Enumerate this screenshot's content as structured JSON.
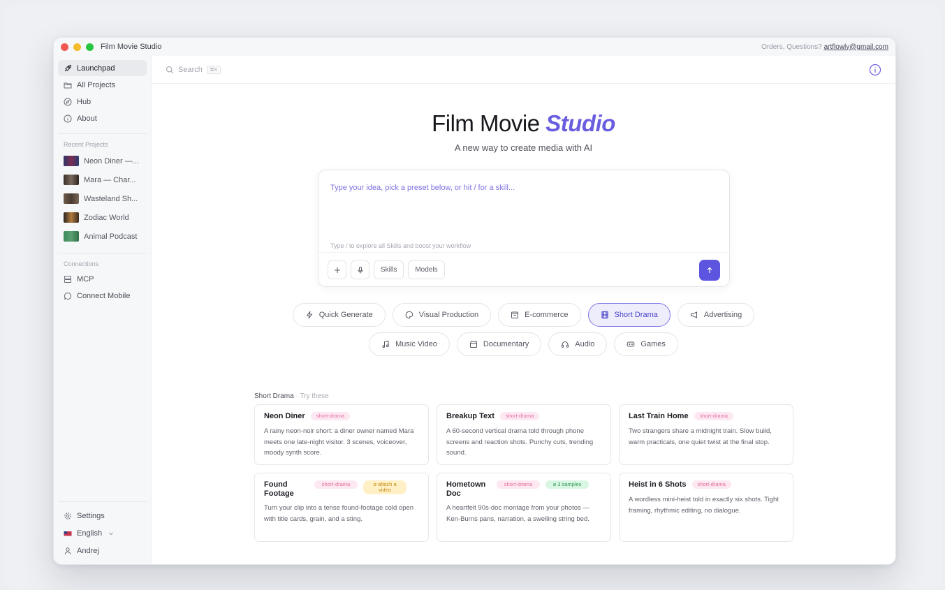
{
  "window": {
    "app_name": "Film Movie Studio",
    "contact_prefix": "Orders, Questions?",
    "contact_email": "artflowly@gmail.com"
  },
  "sidebar": {
    "nav": [
      {
        "label": "Launchpad",
        "icon": "rocket-icon",
        "active": true
      },
      {
        "label": "All Projects",
        "icon": "folder-icon"
      },
      {
        "label": "Hub",
        "icon": "compass-icon"
      },
      {
        "label": "About",
        "icon": "info-icon"
      }
    ],
    "recent_label": "Recent Projects",
    "recent": [
      {
        "label": "Neon Diner —..."
      },
      {
        "label": "Mara — Char..."
      },
      {
        "label": "Wasteland Sh..."
      },
      {
        "label": "Zodiac World"
      },
      {
        "label": "Animal Podcast"
      }
    ],
    "connections_label": "Connections",
    "connections": [
      {
        "label": "MCP",
        "icon": "server-icon"
      },
      {
        "label": "Connect Mobile",
        "icon": "chat-icon"
      }
    ],
    "bottom": {
      "settings": "Settings",
      "language": "English",
      "user": "Andrej"
    }
  },
  "topbar": {
    "search_placeholder": "Search",
    "search_shortcut": "⌘K"
  },
  "hero": {
    "title_main": "Film Movie",
    "title_accent": "Studio",
    "subtitle": "A new way to create media with AI"
  },
  "prompt": {
    "placeholder": "Type your idea, pick a preset below, or hit / for a skill...",
    "hint": "Type / to explore all Skills and boost your workflow",
    "skills_label": "Skills",
    "models_label": "Models"
  },
  "categories_row1": [
    {
      "label": "Quick Generate",
      "icon": "zap-icon"
    },
    {
      "label": "Visual Production",
      "icon": "palette-icon"
    },
    {
      "label": "E-commerce",
      "icon": "shop-icon"
    },
    {
      "label": "Short Drama",
      "icon": "film-icon",
      "active": true
    },
    {
      "label": "Advertising",
      "icon": "megaphone-icon"
    }
  ],
  "categories_row2": [
    {
      "label": "Music Video",
      "icon": "music-icon"
    },
    {
      "label": "Documentary",
      "icon": "clapper-icon"
    },
    {
      "label": "Audio",
      "icon": "headphones-icon"
    },
    {
      "label": "Games",
      "icon": "gamepad-icon"
    }
  ],
  "section": {
    "title": "Short Drama",
    "hint": " · Try these"
  },
  "cards": [
    {
      "title": "Neon Diner",
      "tags": [
        "short-drama"
      ],
      "desc": "A rainy neon-noir short: a diner owner named Mara meets one late-night visitor. 3 scenes, voiceover, moody synth score."
    },
    {
      "title": "Breakup Text",
      "tags": [
        "short-drama"
      ],
      "desc": "A 60-second vertical drama told through phone screens and reaction shots. Punchy cuts, trending sound."
    },
    {
      "title": "Last Train Home",
      "tags": [
        "short-drama"
      ],
      "desc": "Two strangers share a midnight train. Slow build, warm practicals, one quiet twist at the final stop."
    },
    {
      "title": "Found Footage",
      "tags": [
        "short-drama",
        "attach a video"
      ],
      "desc": "Turn your clip into a tense found-footage cold open with title cards, grain, and a sting."
    },
    {
      "title": "Hometown Doc",
      "tags": [
        "short-drama",
        "3 samples"
      ],
      "desc": "A heartfelt 90s-doc montage from your photos — Ken-Burns pans, narration, a swelling string bed."
    },
    {
      "title": "Heist in 6 Shots",
      "tags": [
        "short-drama"
      ],
      "desc": "A wordless mini-heist told in exactly six shots. Tight framing, rhythmic editing, no dialogue."
    }
  ],
  "colors": {
    "accent": "#6a5ee0",
    "send_button": "#5d54e0",
    "traffic_red": "#f0584f",
    "traffic_yellow": "#f3bb2d",
    "traffic_green": "#28c640",
    "tag_pink": "#fde8f1",
    "tag_yellow": "#fff0c6",
    "tag_green": "#d9f6e3"
  }
}
